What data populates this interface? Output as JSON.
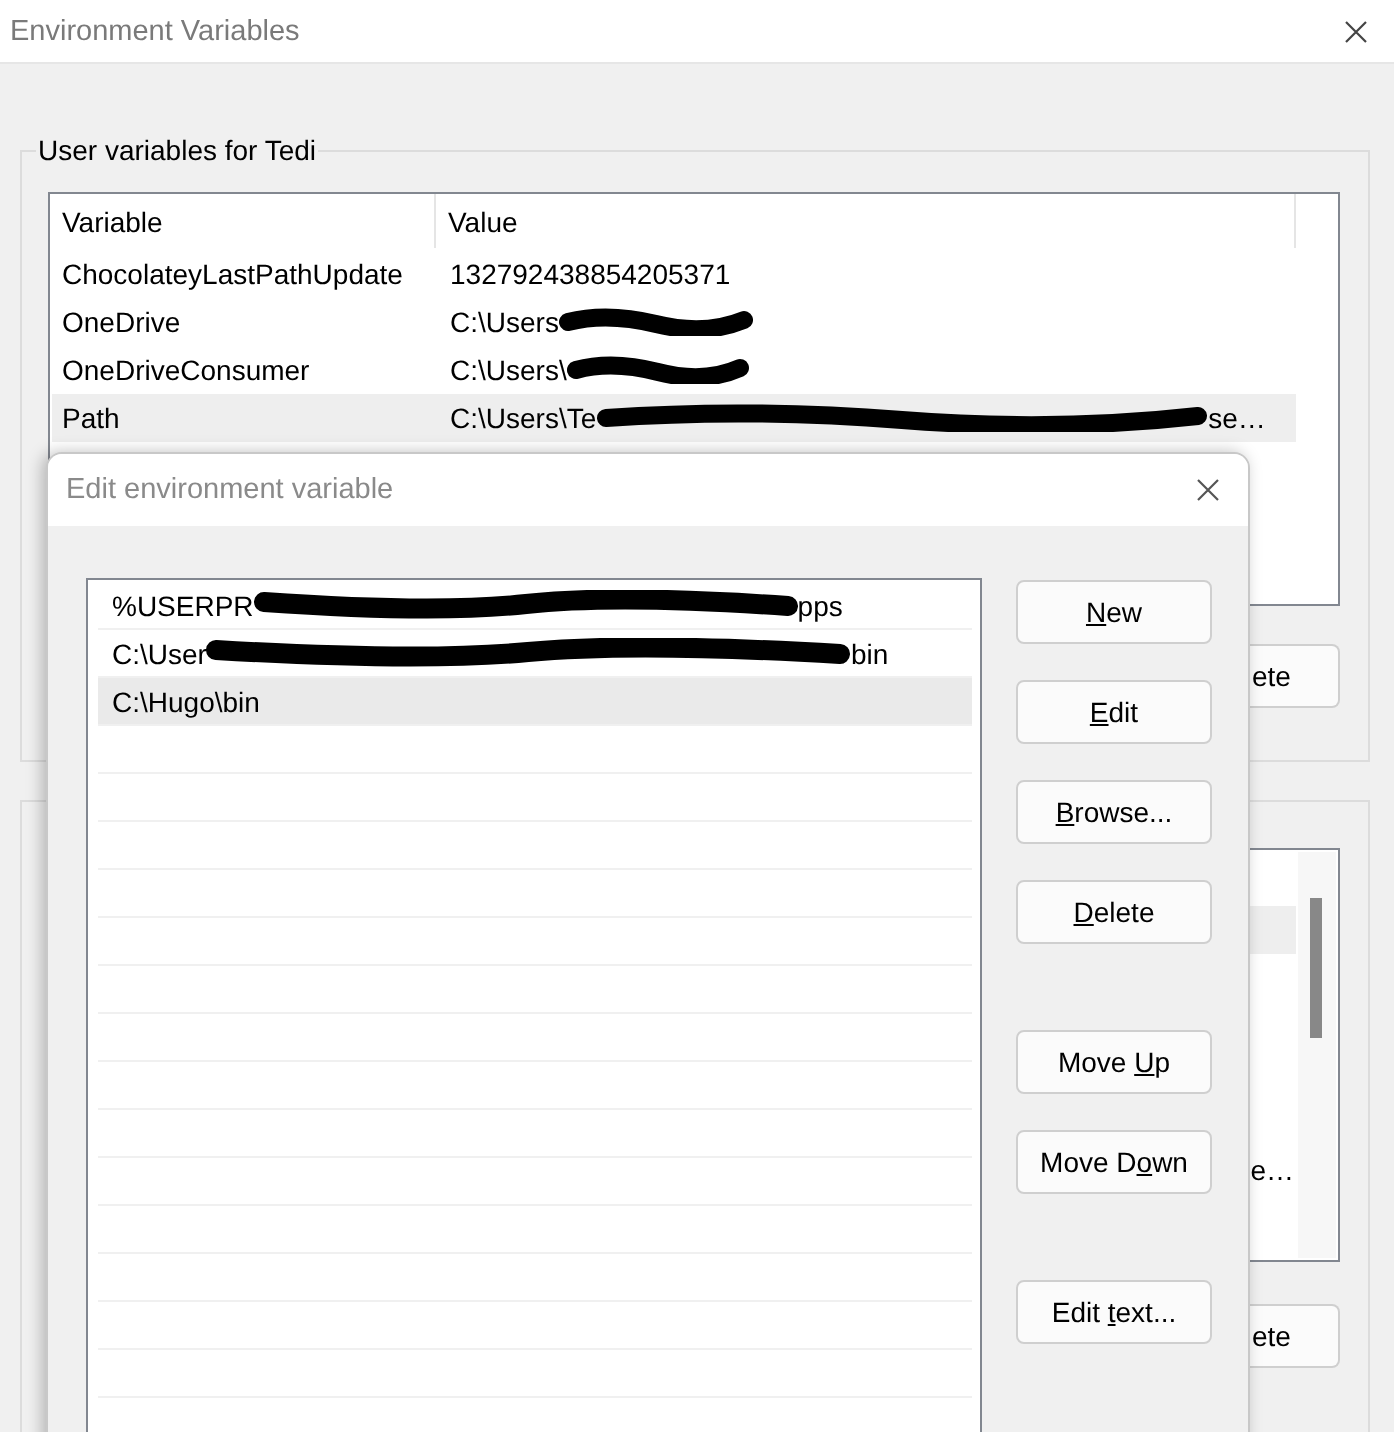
{
  "window": {
    "title": "Environment Variables"
  },
  "user_variables": {
    "label": "User variables for Tedi",
    "columns": [
      "Variable",
      "Value"
    ],
    "rows": [
      {
        "variable": "ChocolateyLastPathUpdate",
        "value": [
          {
            "kind": "text",
            "text": "132792438854205371"
          }
        ],
        "selected": false
      },
      {
        "variable": "OneDrive",
        "value": [
          {
            "kind": "text",
            "text": "C:\\Users"
          },
          {
            "kind": "redaction"
          }
        ],
        "selected": false
      },
      {
        "variable": "OneDriveConsumer",
        "value": [
          {
            "kind": "text",
            "text": "C:\\Users\\"
          },
          {
            "kind": "redaction"
          }
        ],
        "selected": false
      },
      {
        "variable": "Path",
        "value": [
          {
            "kind": "text",
            "text": "C:\\Users\\Te"
          },
          {
            "kind": "redaction"
          },
          {
            "kind": "text",
            "text": "se…"
          }
        ],
        "selected": true
      }
    ],
    "buttons": [
      "ete"
    ]
  },
  "system_variables": {
    "rows": [
      {
        "selected": true
      },
      {
        "selected": false
      },
      {
        "selected": false
      },
      {
        "selected": false
      },
      {
        "selected": false
      },
      {
        "selected": false,
        "value_tail": "e…"
      },
      {
        "selected": false
      }
    ],
    "buttons": [
      "ete"
    ]
  },
  "dialog": {
    "title": "Edit environment variable",
    "entries": [
      {
        "parts": [
          {
            "kind": "text",
            "text": "%USERPR"
          },
          {
            "kind": "redaction"
          },
          {
            "kind": "text",
            "text": "pps"
          }
        ],
        "selected": false
      },
      {
        "parts": [
          {
            "kind": "text",
            "text": "C:\\User"
          },
          {
            "kind": "redaction"
          },
          {
            "kind": "text",
            "text": "bin"
          }
        ],
        "selected": false
      },
      {
        "parts": [
          {
            "kind": "text",
            "text": "C:\\Hugo\\bin"
          }
        ],
        "selected": true
      }
    ],
    "button_groups": [
      [
        {
          "key": "N",
          "after": "ew"
        },
        {
          "key": "E",
          "after": "dit"
        },
        {
          "key": "B",
          "after": "rowse..."
        },
        {
          "key": "D",
          "after": "elete"
        }
      ],
      [
        {
          "before": "Move ",
          "key": "U",
          "after": "p"
        },
        {
          "before": "Move D",
          "key": "o",
          "after": "wn"
        }
      ],
      [
        {
          "before": "Edit ",
          "key": "t",
          "after": "ext..."
        }
      ]
    ]
  }
}
